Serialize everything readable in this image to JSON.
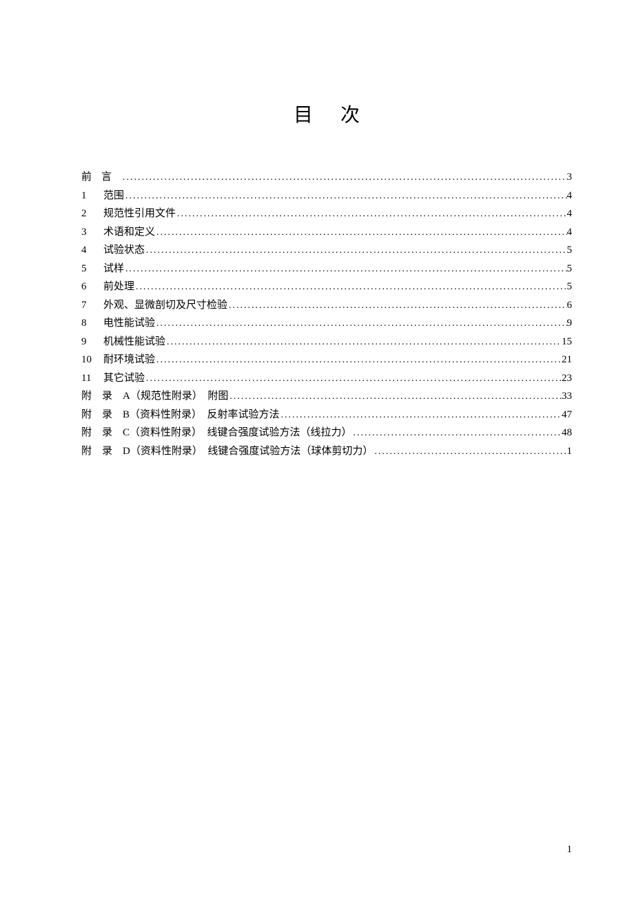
{
  "title": "目次",
  "toc": [
    {
      "label": "前",
      "labelWide": "言",
      "text": "",
      "page": "3"
    },
    {
      "label": "1",
      "text": "范围",
      "page": "4"
    },
    {
      "label": "2",
      "text": "规范性引用文件",
      "page": "4"
    },
    {
      "label": "3",
      "text": "术语和定义",
      "page": "4"
    },
    {
      "label": "4",
      "text": "试验状态",
      "page": "5"
    },
    {
      "label": "5",
      "text": "试样",
      "page": "5"
    },
    {
      "label": "6",
      "text": "前处理",
      "page": "5"
    },
    {
      "label": "7",
      "text": "外观、显微剖切及尺寸检验",
      "page": "6"
    },
    {
      "label": "8",
      "text": "电性能试验",
      "page": "9"
    },
    {
      "label": "9",
      "text": "机械性能试验",
      "page": "15"
    },
    {
      "label": "10",
      "text": "耐环境试验",
      "page": "21"
    },
    {
      "label": "11",
      "text": "其它试验",
      "page": "23"
    },
    {
      "label": "附　录　A",
      "note": "（规范性附录）",
      "text": "附图",
      "page": "33"
    },
    {
      "label": "附　录　B",
      "note": "（资料性附录）",
      "text": "反射率试验方法",
      "page": "47"
    },
    {
      "label": "附　录　C",
      "note": "（资料性附录）",
      "text": "线键合强度试验方法（线拉力）",
      "page": "48"
    },
    {
      "label": "附　录　D",
      "note": "（资料性附录）",
      "text": "线键合强度试验方法（球体剪切力）",
      "page": "1"
    }
  ],
  "footerPage": "1"
}
